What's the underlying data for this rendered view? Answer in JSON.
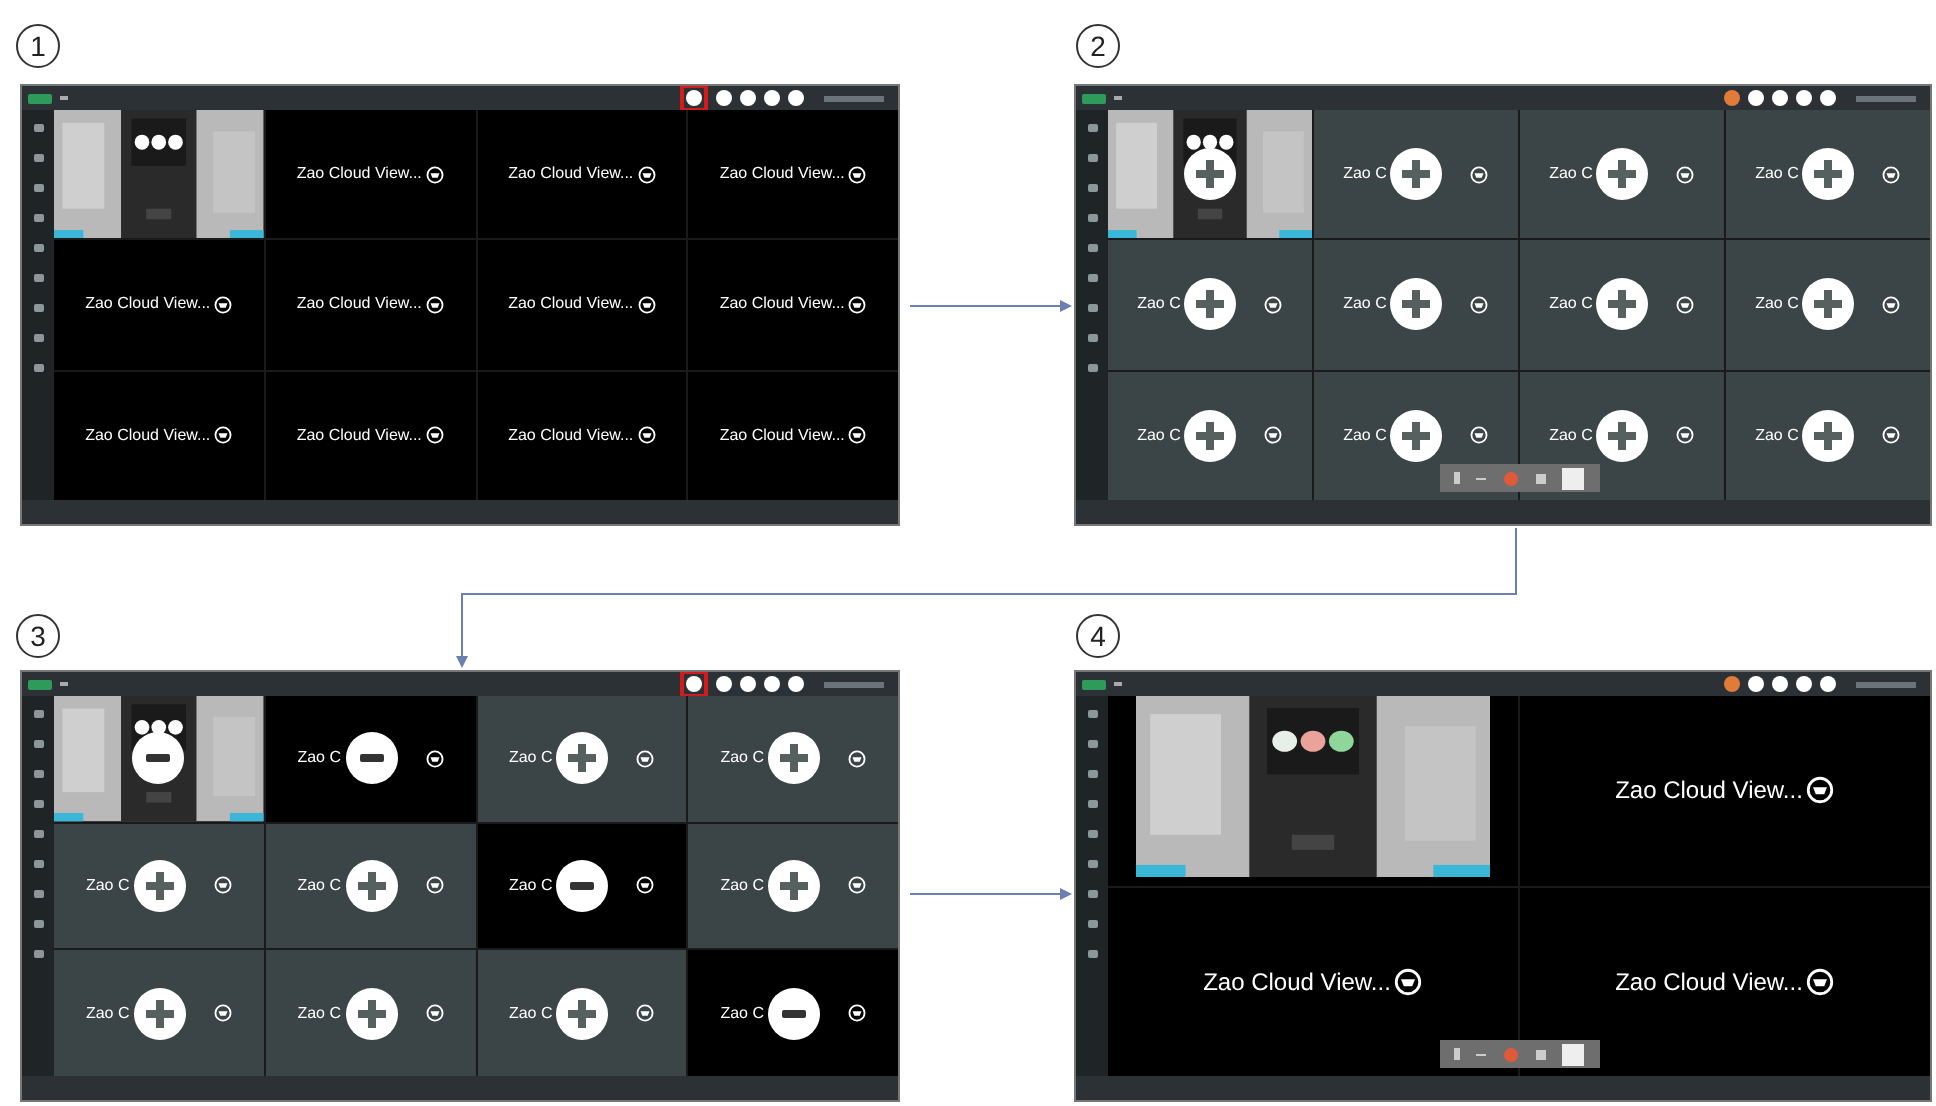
{
  "panels": [
    {
      "number": "1",
      "highlight": true,
      "tool_active": false,
      "toolbar": false,
      "tiles": [
        {
          "kind": "camera"
        },
        {
          "kind": "logo",
          "label": "Zao Cloud View..."
        },
        {
          "kind": "logo",
          "label": "Zao Cloud View..."
        },
        {
          "kind": "logo",
          "label": "Zao Cloud View..."
        },
        {
          "kind": "logo",
          "label": "Zao Cloud View..."
        },
        {
          "kind": "logo",
          "label": "Zao Cloud View..."
        },
        {
          "kind": "logo",
          "label": "Zao Cloud View..."
        },
        {
          "kind": "logo",
          "label": "Zao Cloud View..."
        },
        {
          "kind": "logo",
          "label": "Zao Cloud View..."
        },
        {
          "kind": "logo",
          "label": "Zao Cloud View..."
        },
        {
          "kind": "logo",
          "label": "Zao Cloud View..."
        },
        {
          "kind": "logo",
          "label": "Zao Cloud View..."
        }
      ]
    },
    {
      "number": "2",
      "highlight": false,
      "tool_active": true,
      "toolbar": true,
      "tiles": [
        {
          "kind": "camera",
          "selected": false
        },
        {
          "kind": "logo",
          "label": "Zao C",
          "selected": false
        },
        {
          "kind": "logo",
          "label": "Zao C",
          "selected": false
        },
        {
          "kind": "logo",
          "label": "Zao C",
          "selected": false
        },
        {
          "kind": "logo",
          "label": "Zao C",
          "selected": false
        },
        {
          "kind": "logo",
          "label": "Zao C",
          "selected": false
        },
        {
          "kind": "logo",
          "label": "Zao C",
          "selected": false
        },
        {
          "kind": "logo",
          "label": "Zao C",
          "selected": false
        },
        {
          "kind": "logo",
          "label": "Zao C",
          "selected": false
        },
        {
          "kind": "logo",
          "label": "Zao C",
          "selected": false
        },
        {
          "kind": "logo",
          "label": "Zao C",
          "selected": false
        },
        {
          "kind": "logo",
          "label": "Zao C",
          "selected": false
        }
      ]
    },
    {
      "number": "3",
      "highlight": true,
      "tool_active": false,
      "toolbar": false,
      "tiles": [
        {
          "kind": "camera",
          "selected": true
        },
        {
          "kind": "logo",
          "label": "Zao C",
          "selected": true
        },
        {
          "kind": "logo",
          "label": "Zao C",
          "selected": false
        },
        {
          "kind": "logo",
          "label": "Zao C",
          "selected": false
        },
        {
          "kind": "logo",
          "label": "Zao C",
          "selected": false
        },
        {
          "kind": "logo",
          "label": "Zao C",
          "selected": false
        },
        {
          "kind": "logo",
          "label": "Zao C",
          "selected": true
        },
        {
          "kind": "logo",
          "label": "Zao C",
          "selected": false
        },
        {
          "kind": "logo",
          "label": "Zao C",
          "selected": false
        },
        {
          "kind": "logo",
          "label": "Zao C",
          "selected": false
        },
        {
          "kind": "logo",
          "label": "Zao C",
          "selected": false
        },
        {
          "kind": "logo",
          "label": "Zao C",
          "selected": true
        }
      ]
    },
    {
      "number": "4",
      "highlight": false,
      "tool_active": true,
      "toolbar": true,
      "tiles": [
        {
          "kind": "camera"
        },
        {
          "kind": "logo",
          "label": "Zao Cloud View..."
        },
        {
          "kind": "logo",
          "label": "Zao Cloud View..."
        },
        {
          "kind": "logo",
          "label": "Zao Cloud View..."
        }
      ]
    }
  ]
}
